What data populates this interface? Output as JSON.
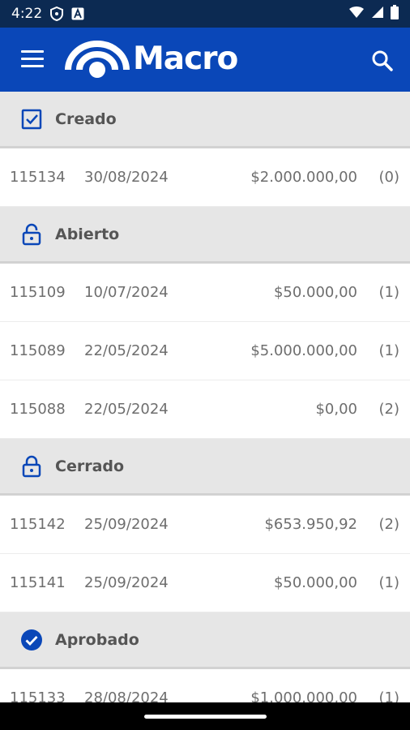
{
  "status_bar": {
    "time": "4:22",
    "icons": [
      "shield-icon",
      "a-badge-icon",
      "wifi-icon",
      "signal-icon",
      "battery-icon"
    ]
  },
  "app_bar": {
    "logo_text": "Macro",
    "colors": {
      "bar": "#0a47b8",
      "accent": "#0a47b8"
    }
  },
  "sections": [
    {
      "label": "Creado",
      "icon": "checkbox-checked-icon",
      "rows": [
        {
          "id": "115134",
          "date": "30/08/2024",
          "amount": "$2.000.000,00",
          "count": "(0)"
        }
      ]
    },
    {
      "label": "Abierto",
      "icon": "lock-open-icon",
      "rows": [
        {
          "id": "115109",
          "date": "10/07/2024",
          "amount": "$50.000,00",
          "count": "(1)"
        },
        {
          "id": "115089",
          "date": "22/05/2024",
          "amount": "$5.000.000,00",
          "count": "(1)"
        },
        {
          "id": "115088",
          "date": "22/05/2024",
          "amount": "$0,00",
          "count": "(2)"
        }
      ]
    },
    {
      "label": "Cerrado",
      "icon": "lock-closed-icon",
      "rows": [
        {
          "id": "115142",
          "date": "25/09/2024",
          "amount": "$653.950,92",
          "count": "(2)"
        },
        {
          "id": "115141",
          "date": "25/09/2024",
          "amount": "$50.000,00",
          "count": "(1)"
        }
      ]
    },
    {
      "label": "Aprobado",
      "icon": "check-circle-icon",
      "rows": [
        {
          "id": "115133",
          "date": "28/08/2024",
          "amount": "$1.000.000,00",
          "count": "(1)"
        }
      ]
    }
  ]
}
